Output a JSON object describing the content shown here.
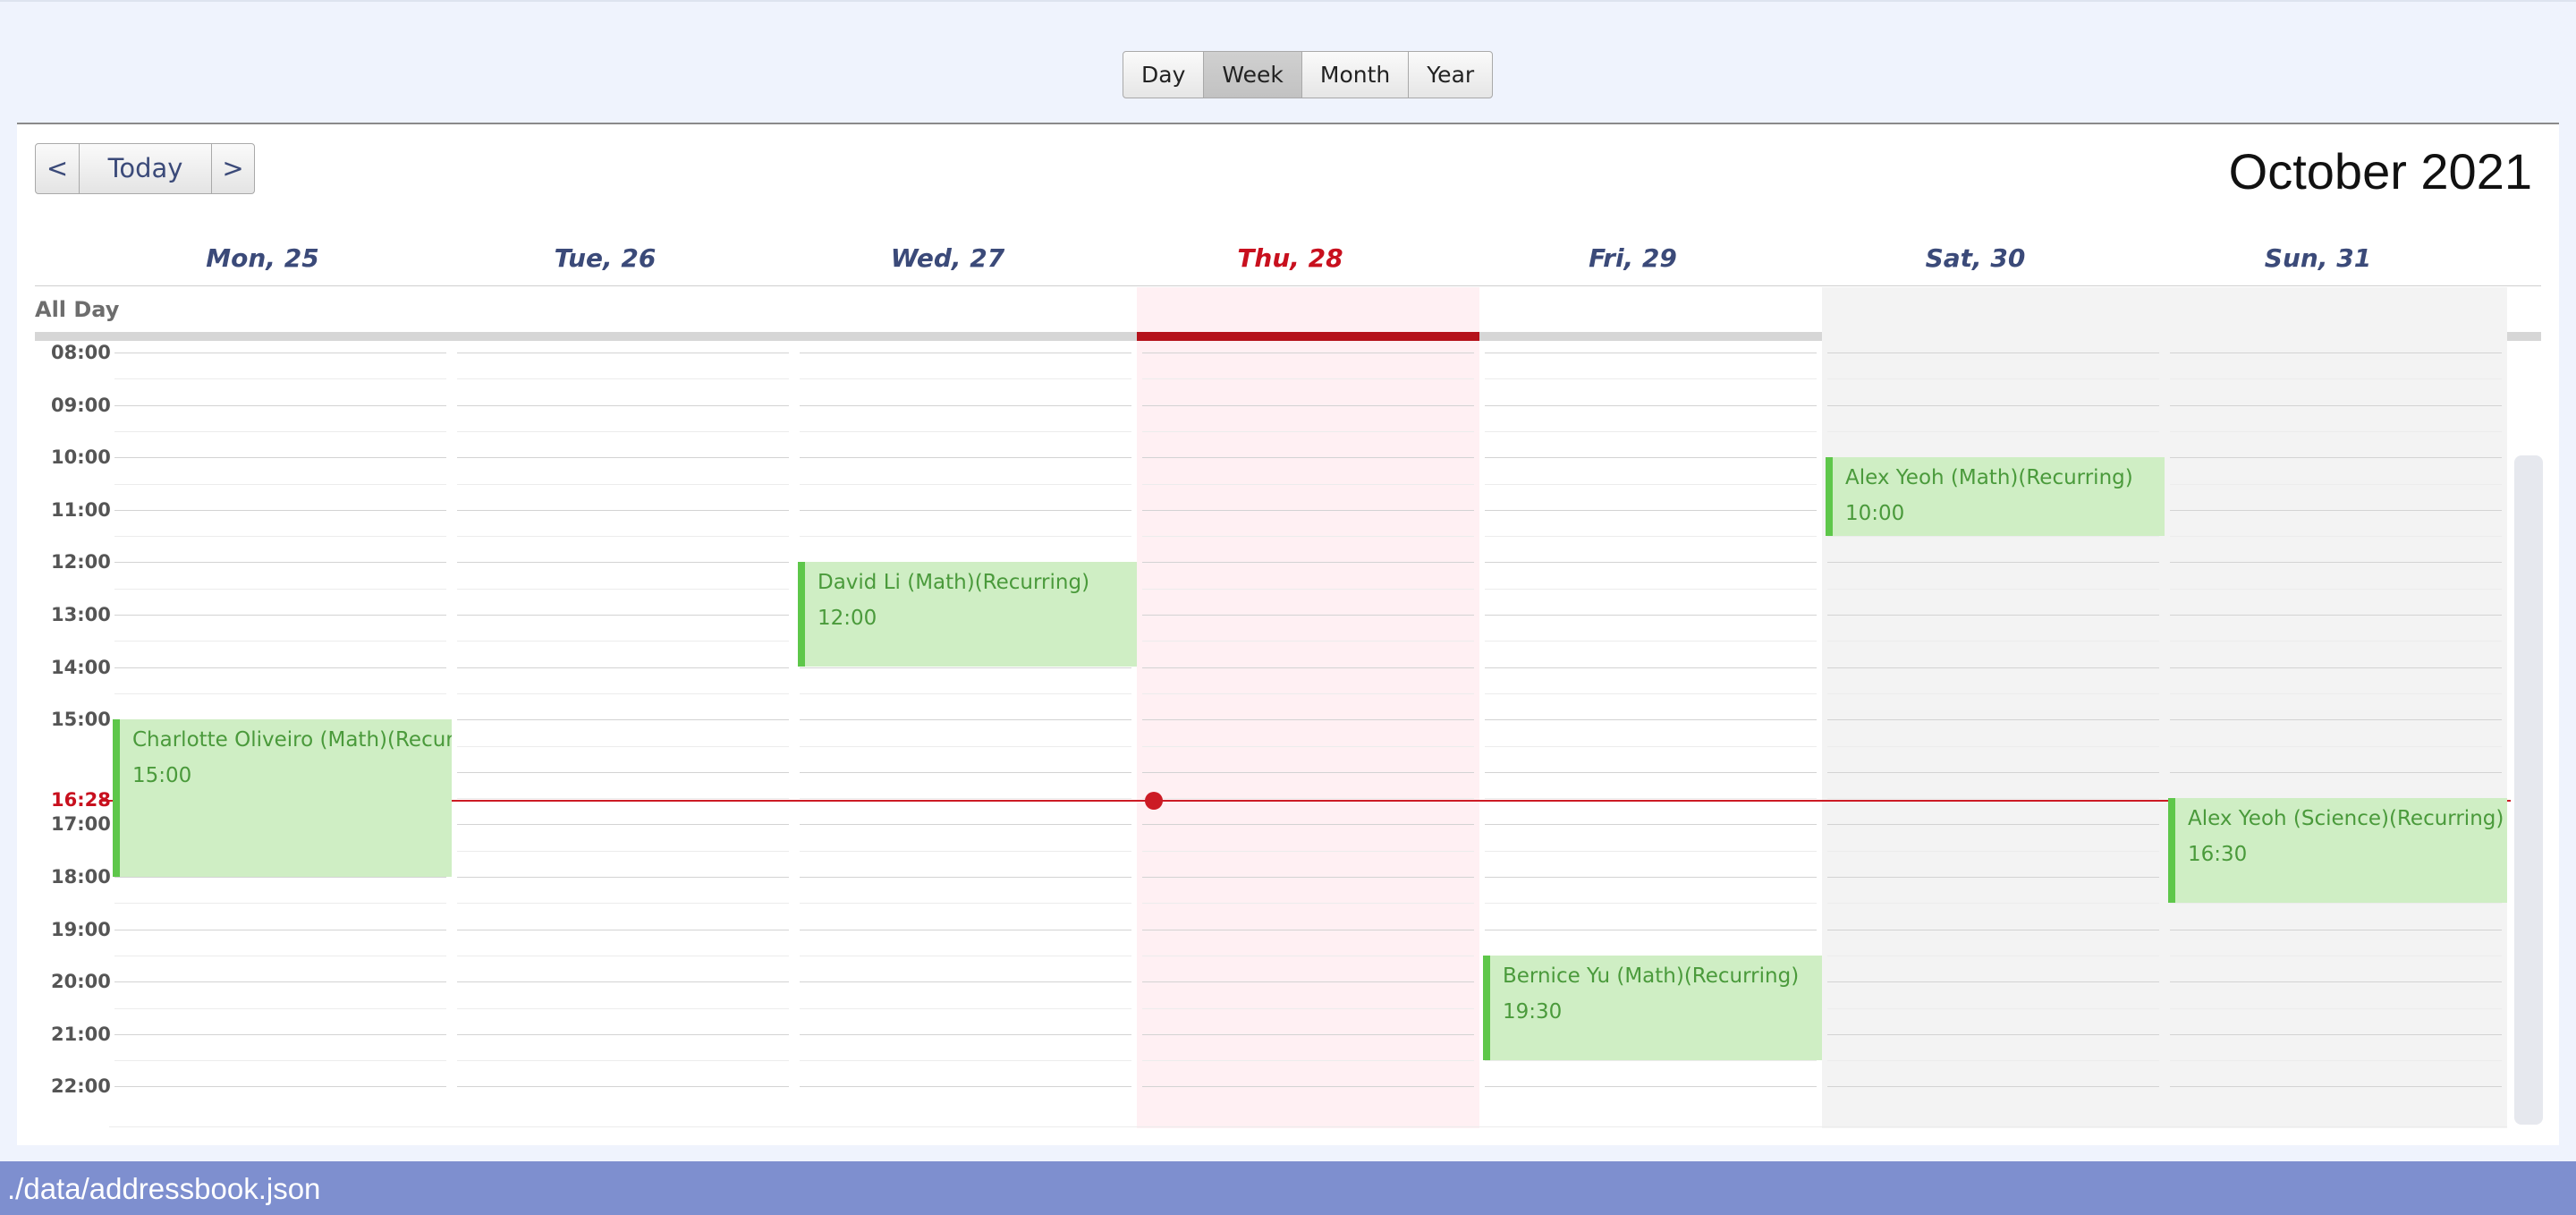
{
  "views": [
    {
      "label": "Day",
      "active": false
    },
    {
      "label": "Week",
      "active": true
    },
    {
      "label": "Month",
      "active": false
    },
    {
      "label": "Year",
      "active": false
    }
  ],
  "nav": {
    "prev": "<",
    "today": "Today",
    "next": ">"
  },
  "month_title": "October 2021",
  "all_day_label": "All Day",
  "days": [
    {
      "label": "Mon, 25",
      "today": false,
      "weekend": false
    },
    {
      "label": "Tue, 26",
      "today": false,
      "weekend": false
    },
    {
      "label": "Wed, 27",
      "today": false,
      "weekend": false
    },
    {
      "label": "Thu, 28",
      "today": true,
      "weekend": false
    },
    {
      "label": "Fri, 29",
      "today": false,
      "weekend": false
    },
    {
      "label": "Sat, 30",
      "today": false,
      "weekend": true
    },
    {
      "label": "Sun, 31",
      "today": false,
      "weekend": true
    }
  ],
  "hours": [
    "08:00",
    "09:00",
    "10:00",
    "11:00",
    "12:00",
    "13:00",
    "14:00",
    "15:00",
    "17:00",
    "18:00",
    "19:00",
    "20:00",
    "21:00",
    "22:00"
  ],
  "current_time": "16:28",
  "events": [
    {
      "day": 0,
      "title": "Charlotte Oliveiro (Math)(Recurring)",
      "time": "15:00",
      "start": 15.0,
      "end": 18.0
    },
    {
      "day": 2,
      "title": "David Li (Math)(Recurring)",
      "time": "12:00",
      "start": 12.0,
      "end": 14.0
    },
    {
      "day": 4,
      "title": "Bernice Yu (Math)(Recurring)",
      "time": "19:30",
      "start": 19.5,
      "end": 21.5
    },
    {
      "day": 5,
      "title": "Alex Yeoh (Math)(Recurring)",
      "time": "10:00",
      "start": 10.0,
      "end": 11.5
    },
    {
      "day": 6,
      "title": "Alex Yeoh (Science)(Recurring)",
      "time": "16:30",
      "start": 16.5,
      "end": 18.5
    }
  ],
  "status": {
    "path": "./data/addressbook.json"
  },
  "colors": {
    "today": "#c8101e",
    "event_bg": "#cfeec4",
    "event_bar": "#5ec74a",
    "status_bar": "#7e8fcf"
  }
}
